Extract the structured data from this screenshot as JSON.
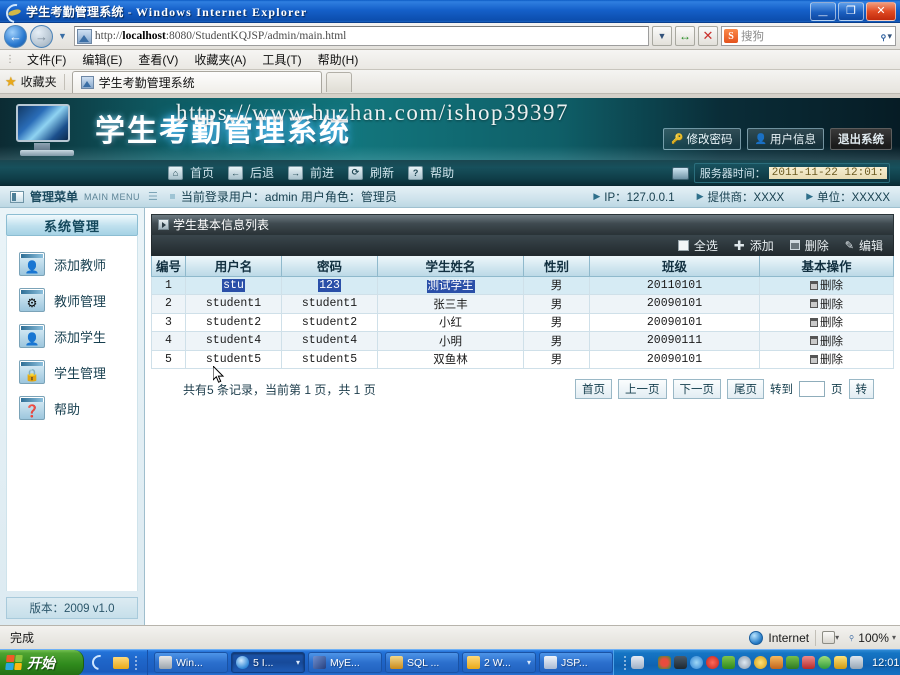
{
  "browser": {
    "title": "学生考勤管理系统",
    "title_separator": "-",
    "app_name": "Windows Internet Explorer",
    "window_buttons": {
      "minimize": "_",
      "maximize": "❐",
      "close": "✕"
    },
    "address": {
      "prefix": "http://",
      "host": "localhost",
      "rest": ":8080/StudentKQJSP/admin/main.html"
    },
    "address_dropdown": "▼",
    "refresh_label": "↔",
    "stop_label": "✕",
    "search": {
      "engine_badge": "S",
      "placeholder": "搜狗",
      "go_icon": "search-icon",
      "caret": "▾"
    },
    "menu": [
      "文件(F)",
      "编辑(E)",
      "查看(V)",
      "收藏夹(A)",
      "工具(T)",
      "帮助(H)"
    ],
    "favorites_label": "收藏夹",
    "tab_label": "学生考勤管理系统"
  },
  "banner": {
    "title_part1": "学生",
    "title_part2": "考勤管理系统",
    "watermark": "https://www.huzhan.com/ishop39397",
    "actions": [
      {
        "label": "修改密码",
        "icon": "key-icon",
        "primary": false
      },
      {
        "label": "用户信息",
        "icon": "user-icon",
        "primary": false
      },
      {
        "label": "退出系统",
        "icon": "",
        "primary": true
      }
    ]
  },
  "navstrip": {
    "items": [
      {
        "label": "首页",
        "icon": "home-icon",
        "glyph": "⌂"
      },
      {
        "label": "后退",
        "icon": "arrow-left-icon",
        "glyph": "←"
      },
      {
        "label": "前进",
        "icon": "arrow-right-icon",
        "glyph": "→"
      },
      {
        "label": "刷新",
        "icon": "refresh-icon",
        "glyph": "⟳"
      },
      {
        "label": "帮助",
        "icon": "question-icon",
        "glyph": "?"
      }
    ],
    "server_time_label": "服务器时间：",
    "server_time_value": "2011-11-22 12:01:"
  },
  "infobar": {
    "menu_title": "管理菜单",
    "menu_subtitle": "main menu",
    "current_user_text": "当前登录用户：admin   用户角色：管理员",
    "right_items": [
      "IP：127.0.0.1",
      "提供商：XXXX",
      "单位：XXXXX"
    ]
  },
  "sidebar": {
    "header": "系统管理",
    "items": [
      {
        "label": "添加教师",
        "icon": "add-teacher-icon",
        "glyph": "👤"
      },
      {
        "label": "教师管理",
        "icon": "gear-icon",
        "glyph": "⚙"
      },
      {
        "label": "添加学生",
        "icon": "add-student-icon",
        "glyph": "👤"
      },
      {
        "label": "学生管理",
        "icon": "lock-icon",
        "glyph": "🔒"
      },
      {
        "label": "帮助",
        "icon": "help-icon",
        "glyph": "❓"
      }
    ],
    "footer": "版本：2009 v1.0"
  },
  "panel": {
    "title": "学生基本信息列表",
    "toolbar": [
      {
        "label": "全选",
        "icon": "checkbox-icon"
      },
      {
        "label": "添加",
        "icon": "plus-icon"
      },
      {
        "label": "删除",
        "icon": "trash-icon"
      },
      {
        "label": "编辑",
        "icon": "pencil-icon"
      }
    ]
  },
  "table": {
    "columns": [
      "编号",
      "用户名",
      "密码",
      "学生姓名",
      "性别",
      "班级",
      "基本操作"
    ],
    "action_label": "删除",
    "rows": [
      {
        "id": "1",
        "username": "stu",
        "password": "123",
        "name": "测试学生",
        "gender": "男",
        "class": "20110101",
        "selected": true
      },
      {
        "id": "2",
        "username": "student1",
        "password": "student1",
        "name": "张三丰",
        "gender": "男",
        "class": "20090101",
        "selected": false
      },
      {
        "id": "3",
        "username": "student2",
        "password": "student2",
        "name": "小红",
        "gender": "男",
        "class": "20090101",
        "selected": false
      },
      {
        "id": "4",
        "username": "student4",
        "password": "student4",
        "name": "小明",
        "gender": "男",
        "class": "20090111",
        "selected": false
      },
      {
        "id": "5",
        "username": "student5",
        "password": "student5",
        "name": "双鱼林",
        "gender": "男",
        "class": "20090101",
        "selected": false
      }
    ]
  },
  "pager": {
    "summary": "共有5 条记录，当前第 1 页，共 1 页",
    "first": "首页",
    "prev": "上一页",
    "next": "下一页",
    "last": "尾页",
    "goto_label": "转到",
    "goto_value": "",
    "page_unit": "页",
    "go": "转"
  },
  "statusbar": {
    "status": "完成",
    "zone": "Internet",
    "zoom": "100%",
    "caret": "▾"
  },
  "taskbar": {
    "start": "开始",
    "quicklaunch": [
      "ie-icon",
      "folder-icon"
    ],
    "tasks": [
      {
        "label": "Win...",
        "icon": "monitor-icon",
        "color": "#d8d8d8",
        "active": false,
        "caret": ""
      },
      {
        "label": "5 I...",
        "icon": "ie-icon",
        "color": "#7fc3f5",
        "active": true,
        "caret": "▾"
      },
      {
        "label": "MyE...",
        "icon": "myeclipse-icon",
        "color": "#3e6ab8",
        "active": false,
        "caret": ""
      },
      {
        "label": "SQL ...",
        "icon": "sql-icon",
        "color": "#e2b33a",
        "active": false,
        "caret": ""
      },
      {
        "label": "2 W...",
        "icon": "folder-icon",
        "color": "#f1b733",
        "active": false,
        "caret": "▾"
      },
      {
        "label": "JSP...",
        "icon": "word-icon",
        "color": "#cfd8e6",
        "active": false,
        "caret": ""
      }
    ],
    "tray_icons": [
      "p-icon",
      "green-icon",
      "media-icon",
      "blue-icon",
      "record-icon",
      "grid-icon",
      "globe-icon",
      "yellow-icon",
      "qq-icon",
      "leaf-icon",
      "qq2-icon",
      "c-icon",
      "shield-icon",
      "cube-icon"
    ],
    "clock": "12:01"
  }
}
